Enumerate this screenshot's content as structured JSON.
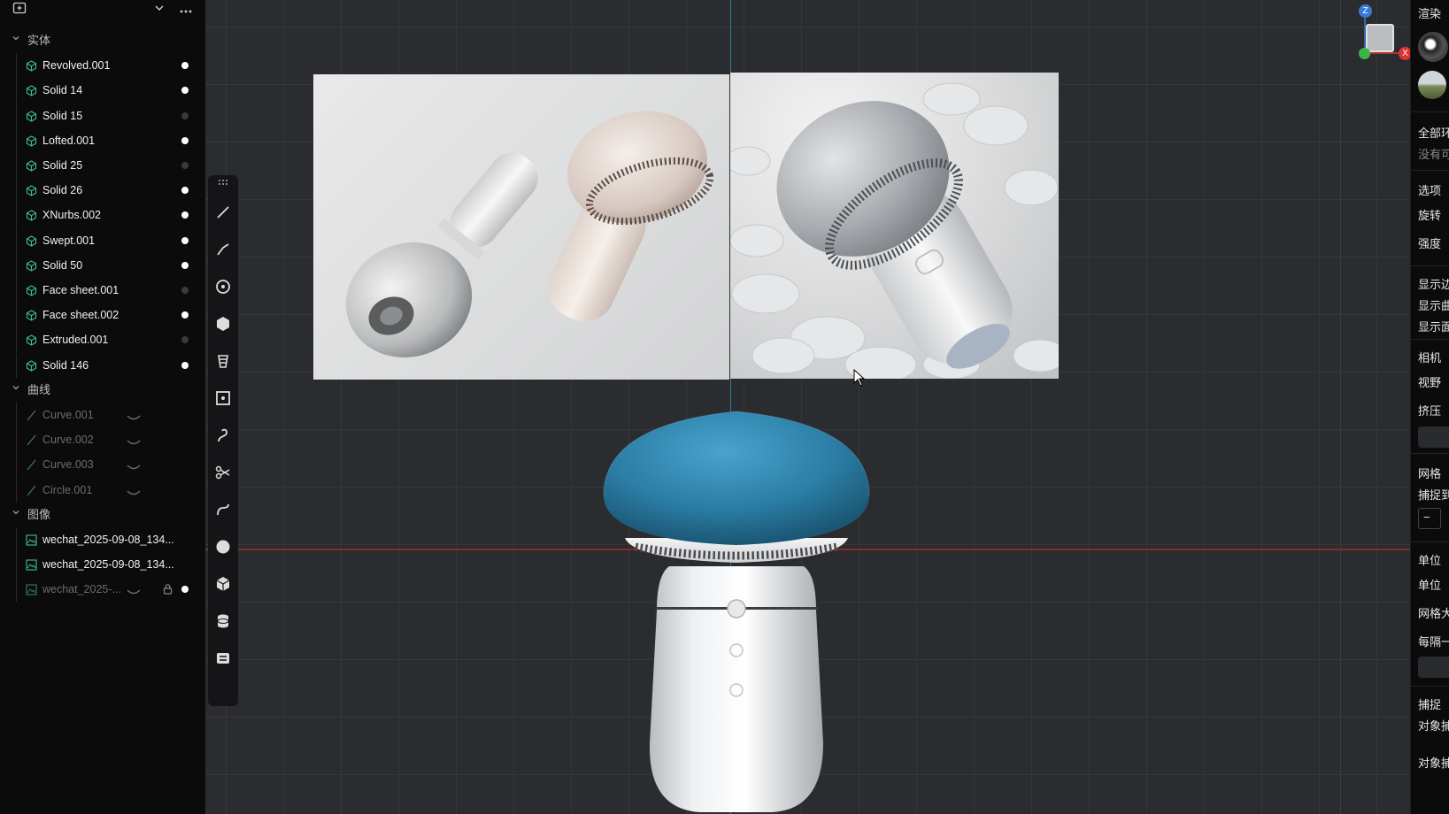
{
  "outliner": {
    "groups": [
      {
        "label": "实体"
      },
      {
        "label": "曲线"
      },
      {
        "label": "图像"
      }
    ],
    "solids": [
      {
        "label": "Revolved.001",
        "visible": true
      },
      {
        "label": "Solid 14",
        "visible": true
      },
      {
        "label": "Solid 15",
        "visible": false
      },
      {
        "label": "Lofted.001",
        "visible": true
      },
      {
        "label": "Solid 25",
        "visible": false
      },
      {
        "label": "Solid 26",
        "visible": true
      },
      {
        "label": "XNurbs.002",
        "visible": true
      },
      {
        "label": "Swept.001",
        "visible": true
      },
      {
        "label": "Solid 50",
        "visible": true
      },
      {
        "label": "Face sheet.001",
        "visible": false
      },
      {
        "label": "Face sheet.002",
        "visible": true
      },
      {
        "label": "Extruded.001",
        "visible": false
      },
      {
        "label": "Solid 146",
        "visible": true
      }
    ],
    "curves": [
      {
        "label": "Curve.001"
      },
      {
        "label": "Curve.002"
      },
      {
        "label": "Curve.003"
      },
      {
        "label": "Circle.001"
      }
    ],
    "images": [
      {
        "label": "wechat_2025-09-08_134..."
      },
      {
        "label": "wechat_2025-09-08_134..."
      },
      {
        "label": "wechat_2025-..."
      }
    ]
  },
  "gizmo": {
    "z_label": "Z",
    "x_label": "X"
  },
  "right_panel": {
    "items": [
      "渲染",
      "全部环",
      "没有可",
      "选项",
      "旋转",
      "强度",
      "显示边",
      "显示曲",
      "显示面",
      "相机",
      "视野",
      "挤压",
      "网格",
      "捕捉到",
      "−",
      "单位",
      "单位",
      "网格大",
      "每隔一",
      "捕捉",
      "对象捕",
      "对象捕"
    ]
  },
  "colors": {
    "accent_teal": "#3fbf9a",
    "axis_red": "#8a2a2a",
    "axis_blue": "#2f7a8c",
    "product_blue": "#2b7ea6"
  }
}
